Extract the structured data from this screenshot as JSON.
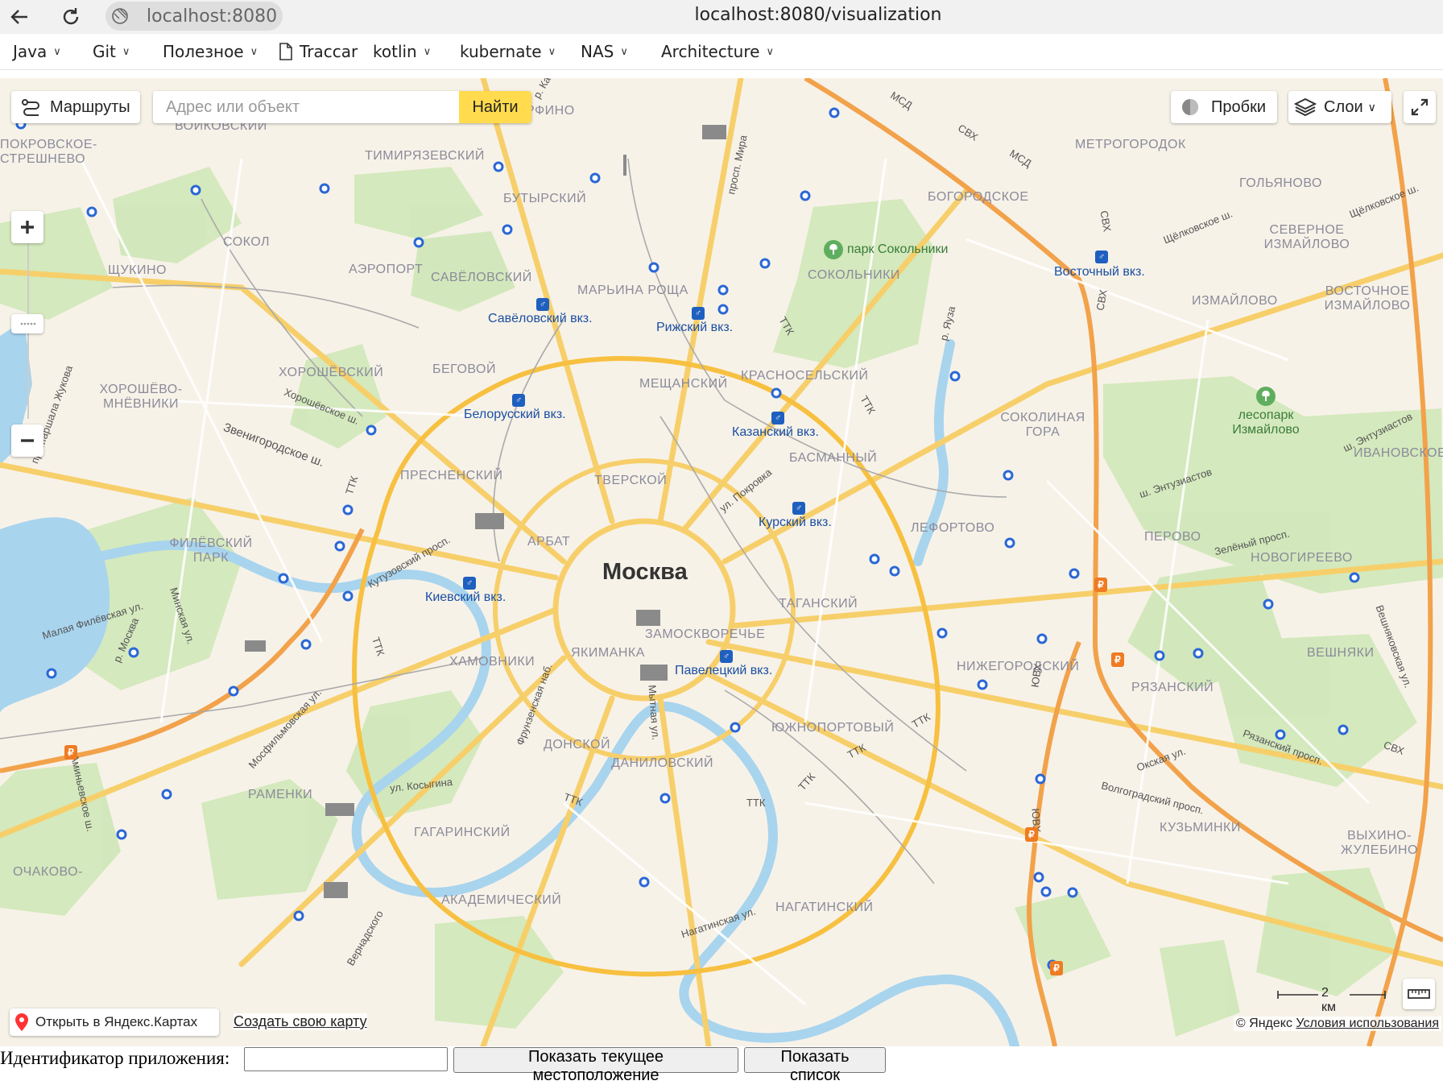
{
  "browser": {
    "host": "localhost:8080",
    "url": "localhost:8080/visualization"
  },
  "bookmarks": [
    {
      "label": "Java",
      "folder": true
    },
    {
      "label": "Git",
      "folder": true
    },
    {
      "label": "Полезное",
      "folder": true
    },
    {
      "label": "Traccar",
      "folder": false
    },
    {
      "label": "kotlin",
      "folder": true
    },
    {
      "label": "kubernate",
      "folder": true
    },
    {
      "label": "NAS",
      "folder": true
    },
    {
      "label": "Architecture",
      "folder": true
    }
  ],
  "map": {
    "routes_label": "Маршруты",
    "search_placeholder": "Адрес или объект",
    "find_label": "Найти",
    "traffic_label": "Пробки",
    "layers_label": "Слои",
    "city": "Москва",
    "open_yandex_label": "Открыть в Яндекс.Картах",
    "create_map_label": "Создать свою карту",
    "scale_label": "2 км",
    "copyright": "© Яндекс",
    "terms_label": "Условия использования",
    "districts": [
      "ВОЙКОВСКИЙ",
      "ТИМИРЯЗЕВСКИЙ",
      "БУТЫРСКИЙ",
      "МАРФИНО",
      "МЕТРОГОРОДОК",
      "ГОЛЬЯНОВО",
      "БОГОРОДСКОЕ",
      "СЕВЕРНОЕ ИЗМАЙЛОВО",
      "СОКОЛ",
      "ЩУКИНО",
      "АЭРОПОРТ",
      "САВЁЛОВСКИЙ",
      "МАРЬИНА РОЩА",
      "СОКОЛЬНИКИ",
      "ИЗМАЙЛОВО",
      "ВОСТОЧНОЕ ИЗМАЙЛОВО",
      "ХОРОШЁВСКИЙ",
      "БЕГОВОЙ",
      "МЕЩАНСКИЙ",
      "КРАСНОСЕЛЬСКИЙ",
      "ХОРОШЁВО-МНЁВНИКИ",
      "СОКОЛИНАЯ ГОРА",
      "БАСМАННЫЙ",
      "ИВАНОВСКОЕ",
      "ПРЕСНЕНСКИЙ",
      "ТВЕРСКОЙ",
      "АРБАТ",
      "ЛЕФОРТОВО",
      "ПЕРОВО",
      "ФИЛЁВСКИЙ ПАРК",
      "НОВОГИРЕЕВО",
      "ТАГАНСКИЙ",
      "ЗАМОСКВОРЕЧЬЕ",
      "ЯКИМАНКА",
      "ХАМОВНИКИ",
      "НИЖЕГОРОДСКИЙ",
      "ВЕШНЯКИ",
      "РЯЗАНСКИЙ",
      "ЮЖНОПОРТОВЫЙ",
      "ДОНСКОЙ",
      "ДАНИЛОВСКИЙ",
      "РАМЕНКИ",
      "ГАГАРИНСКИЙ",
      "КУЗЬМИНКИ",
      "ВЫХИНО-ЖУЛЕБИНО",
      "ОЧАКОВО-",
      "АКАДЕМИЧЕСКИЙ",
      "НАГАТИНСКИЙ",
      "ПОКРОВСКОЕ-СТРЕШНЕВО"
    ],
    "stations": [
      "Савёловский вкз.",
      "Рижский вкз.",
      "Восточный вкз.",
      "Белорусский вкз.",
      "Казанский вкз.",
      "Курский вкз.",
      "Киевский вкз.",
      "Павелецкий вкз."
    ],
    "parks": [
      "парк Сокольники",
      "лесопарк Измайлово"
    ],
    "streets": [
      "МСД",
      "СВХ",
      "ТТК",
      "Хорошёвское ш.",
      "Звенигородское ш.",
      "Кутузовский просп.",
      "Малая Филёвская ул.",
      "Минская ул.",
      "Мосфильмовская ул.",
      "ул. Косыгина",
      "Аминьевское ш.",
      "Фрунзенская наб.",
      "Мытная ул.",
      "ул. Покровка",
      "просп. Мира",
      "р. Яуза",
      "р. Москва",
      "Щёлковское ш.",
      "ш. Энтузиастов",
      "Зелёный просп.",
      "Вешняковская ул.",
      "Рязанский просп.",
      "Окская ул.",
      "Волгоградский просп.",
      "ЮВХ",
      "Нагатинская ул.",
      "Вернадского",
      "р. Кам",
      "пр. Маршала Жукова"
    ]
  },
  "form": {
    "label": "Идентификатор приложения:",
    "input_value": "",
    "show_location_label": "Показать текущее местоположение",
    "show_list_label": "Показать список"
  }
}
